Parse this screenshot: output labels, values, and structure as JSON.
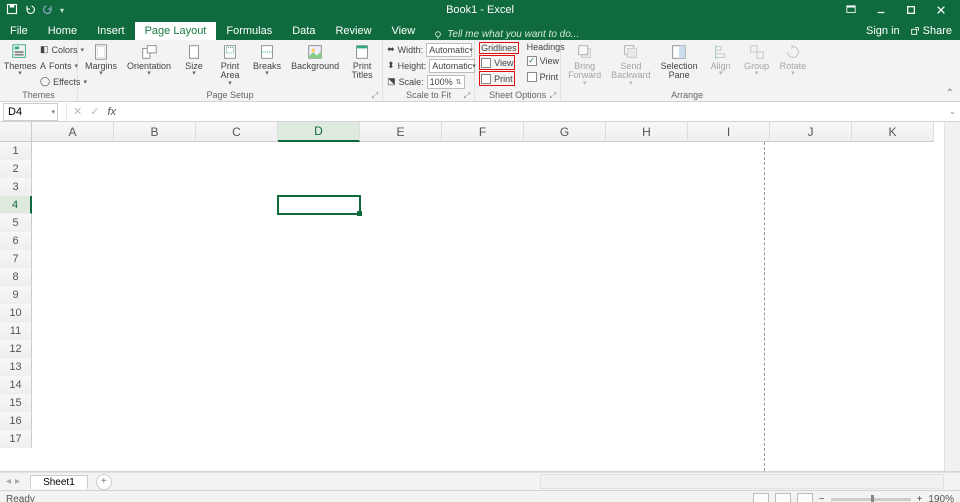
{
  "title": "Book1 - Excel",
  "signin": "Sign in",
  "share": "Share",
  "tabs": [
    "File",
    "Home",
    "Insert",
    "Page Layout",
    "Formulas",
    "Data",
    "Review",
    "View"
  ],
  "active_tab_index": 3,
  "tellme": "Tell me what you want to do...",
  "ribbon": {
    "themes": {
      "label": "Themes",
      "main": "Themes",
      "colors": "Colors",
      "fonts": "Fonts",
      "effects": "Effects"
    },
    "pagesetup": {
      "label": "Page Setup",
      "margins": "Margins",
      "orientation": "Orientation",
      "size": "Size",
      "printarea": "Print\nArea",
      "breaks": "Breaks",
      "background": "Background",
      "printtitles": "Print\nTitles"
    },
    "scale": {
      "label": "Scale to Fit",
      "width": "Width:",
      "height": "Height:",
      "scale": "Scale:",
      "width_val": "Automatic",
      "height_val": "Automatic",
      "scale_val": "100%"
    },
    "sheetoptions": {
      "label": "Sheet Options",
      "gridlines": "Gridlines",
      "headings": "Headings",
      "view": "View",
      "print": "Print",
      "gridlines_view": false,
      "gridlines_print": false,
      "headings_view": true,
      "headings_print": false
    },
    "arrange": {
      "label": "Arrange",
      "bringforward": "Bring\nForward",
      "sendbackward": "Send\nBackward",
      "selectionpane": "Selection\nPane",
      "align": "Align",
      "group": "Group",
      "rotate": "Rotate"
    }
  },
  "namebox": "D4",
  "columns": [
    "A",
    "B",
    "C",
    "D",
    "E",
    "F",
    "G",
    "H",
    "I",
    "J",
    "K"
  ],
  "active_col_index": 3,
  "rows": [
    1,
    2,
    3,
    4,
    5,
    6,
    7,
    8,
    9,
    10,
    11,
    12,
    13,
    14,
    15,
    16,
    17
  ],
  "active_row_index": 3,
  "sheet": "Sheet1",
  "status": {
    "ready": "Ready",
    "zoom": "190%"
  }
}
